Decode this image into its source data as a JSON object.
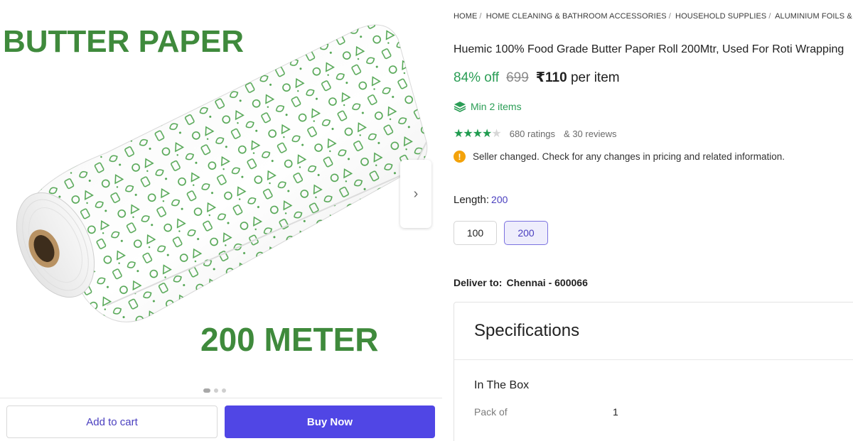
{
  "gallery": {
    "image_heading": "BUTTER PAPER",
    "image_caption": "200 METER",
    "next_arrow": "›",
    "slide_count": 3,
    "active_slide": 1
  },
  "actions": {
    "add_to_cart": "Add to cart",
    "buy_now": "Buy Now"
  },
  "breadcrumb": [
    "HOME",
    "HOME CLEANING & BATHROOM ACCESSORIES",
    "HOUSEHOLD SUPPLIES",
    "ALUMINIUM FOILS & SHRINK WRAPS"
  ],
  "product": {
    "title": "Huemic 100% Food Grade Butter Paper Roll 200Mtr, Used For Roti Wrapping",
    "discount": "84% off",
    "mrp": "699",
    "price": "₹110",
    "price_unit": "per item",
    "min_items": "Min 2 items",
    "rating": 4,
    "ratings_count": "680 ratings",
    "reviews_count": "& 30 reviews",
    "notice": "Seller changed. Check for any changes in pricing and related information.",
    "length_label": "Length:",
    "length_selected": "200",
    "length_options": [
      "100",
      "200"
    ],
    "deliver_label": "Deliver to:",
    "deliver_city": "Chennai - 600066"
  },
  "specifications": {
    "title": "Specifications",
    "section": "In The Box",
    "rows": [
      {
        "key": "Pack of",
        "value": "1"
      }
    ]
  },
  "colors": {
    "accent": "#5046e5",
    "discount_green": "#2a9d55",
    "brand_text_green": "#3f8a3c",
    "warning": "#f3a20a"
  },
  "icons": {
    "next_arrow": "chevron-right-icon",
    "min_items": "layers-icon",
    "notice": "info-icon"
  }
}
